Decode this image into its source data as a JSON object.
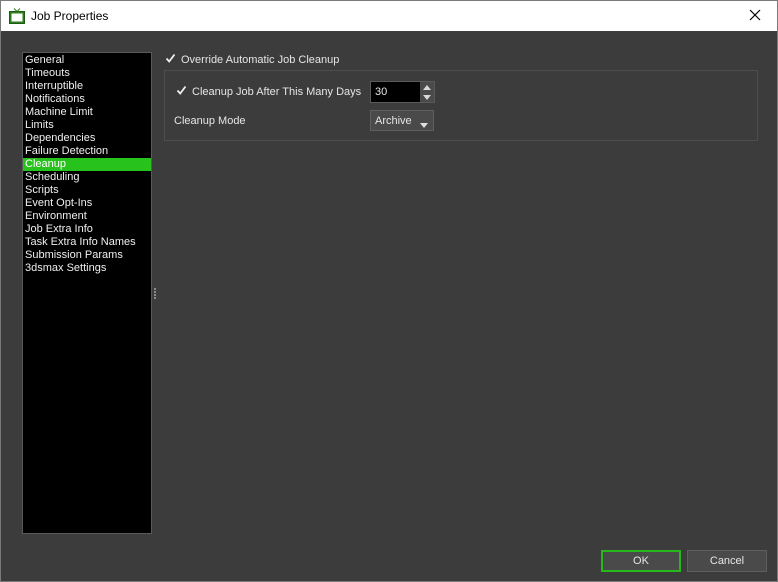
{
  "window": {
    "title": "Job Properties",
    "accent_color": "#27c21b"
  },
  "icons": {
    "app": "tv-icon",
    "close": "close-icon"
  },
  "nav": {
    "items": [
      {
        "label": "General",
        "selected": false
      },
      {
        "label": "Timeouts",
        "selected": false
      },
      {
        "label": "Interruptible",
        "selected": false
      },
      {
        "label": "Notifications",
        "selected": false
      },
      {
        "label": "Machine Limit",
        "selected": false
      },
      {
        "label": "Limits",
        "selected": false
      },
      {
        "label": "Dependencies",
        "selected": false
      },
      {
        "label": "Failure Detection",
        "selected": false
      },
      {
        "label": "Cleanup",
        "selected": true
      },
      {
        "label": "Scheduling",
        "selected": false
      },
      {
        "label": "Scripts",
        "selected": false
      },
      {
        "label": "Event Opt-Ins",
        "selected": false
      },
      {
        "label": "Environment",
        "selected": false
      },
      {
        "label": "Job Extra Info",
        "selected": false
      },
      {
        "label": "Task Extra Info Names",
        "selected": false
      },
      {
        "label": "Submission Params",
        "selected": false
      },
      {
        "label": "3dsmax Settings",
        "selected": false
      }
    ]
  },
  "cleanup": {
    "override_label": "Override Automatic Job Cleanup",
    "override_checked": true,
    "after_days_label": "Cleanup Job After This Many Days",
    "after_days_checked": true,
    "days_value": "30",
    "mode_label": "Cleanup Mode",
    "mode_value": "Archive"
  },
  "buttons": {
    "ok": "OK",
    "cancel": "Cancel"
  }
}
